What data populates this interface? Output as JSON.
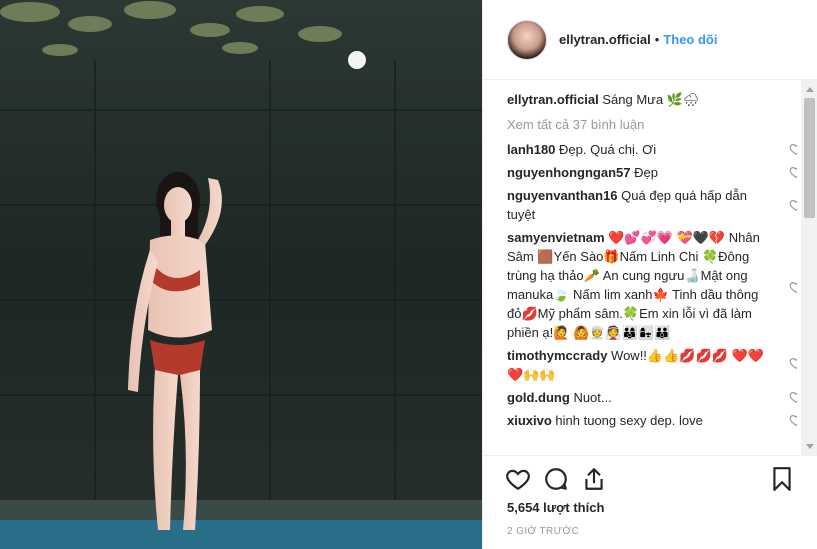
{
  "header": {
    "username": "ellytran.official",
    "separator": "•",
    "follow_label": "Theo dõi"
  },
  "caption": {
    "username": "ellytran.official",
    "text": "Sáng Mưa 🌿🌧"
  },
  "view_all_comments": "Xem tất cả 37 bình luận",
  "comments": [
    {
      "user": "lanh180",
      "text": "Đẹp. Quá chị. Ơi"
    },
    {
      "user": "nguyenhongngan57",
      "text": "Đẹp"
    },
    {
      "user": "nguyenvanthan16",
      "text": "Quá đẹp quá hấp dẫn tuyệt"
    },
    {
      "user": "samyenvietnam",
      "text": "❤️💕💞💗 💝🖤💔 Nhân Sâm 🟫Yến Sào🎁Nấm Linh Chi 🍀Đông trùng hạ thảo🥕 An cung ngưu🍶Mật ong manuka🍃 Nấm lim xanh🍁 Tinh dầu thông đỏ💋Mỹ phẩm sâm.🍀Em xin lỗi vì đã làm phiền ạ!🙋 🙆👳👰👨‍👩‍👦👩‍👧👪"
    },
    {
      "user": "timothymccrady",
      "text": "Wow!!👍👍💋💋💋 ❤️❤️❤️🙌🙌"
    },
    {
      "user": "gold.dung",
      "text": "Nuot..."
    },
    {
      "user": "xiuxivo",
      "text": "hinh tuong sexy dep. love"
    }
  ],
  "likes": "5,654 lượt thích",
  "timestamp": "2 GIỜ TRƯỚC",
  "icons": {
    "like": "heart-icon",
    "comment": "comment-icon",
    "share": "share-icon",
    "save": "bookmark-icon"
  },
  "colors": {
    "accent": "#3897f0",
    "text": "#262626",
    "muted": "#999999"
  }
}
